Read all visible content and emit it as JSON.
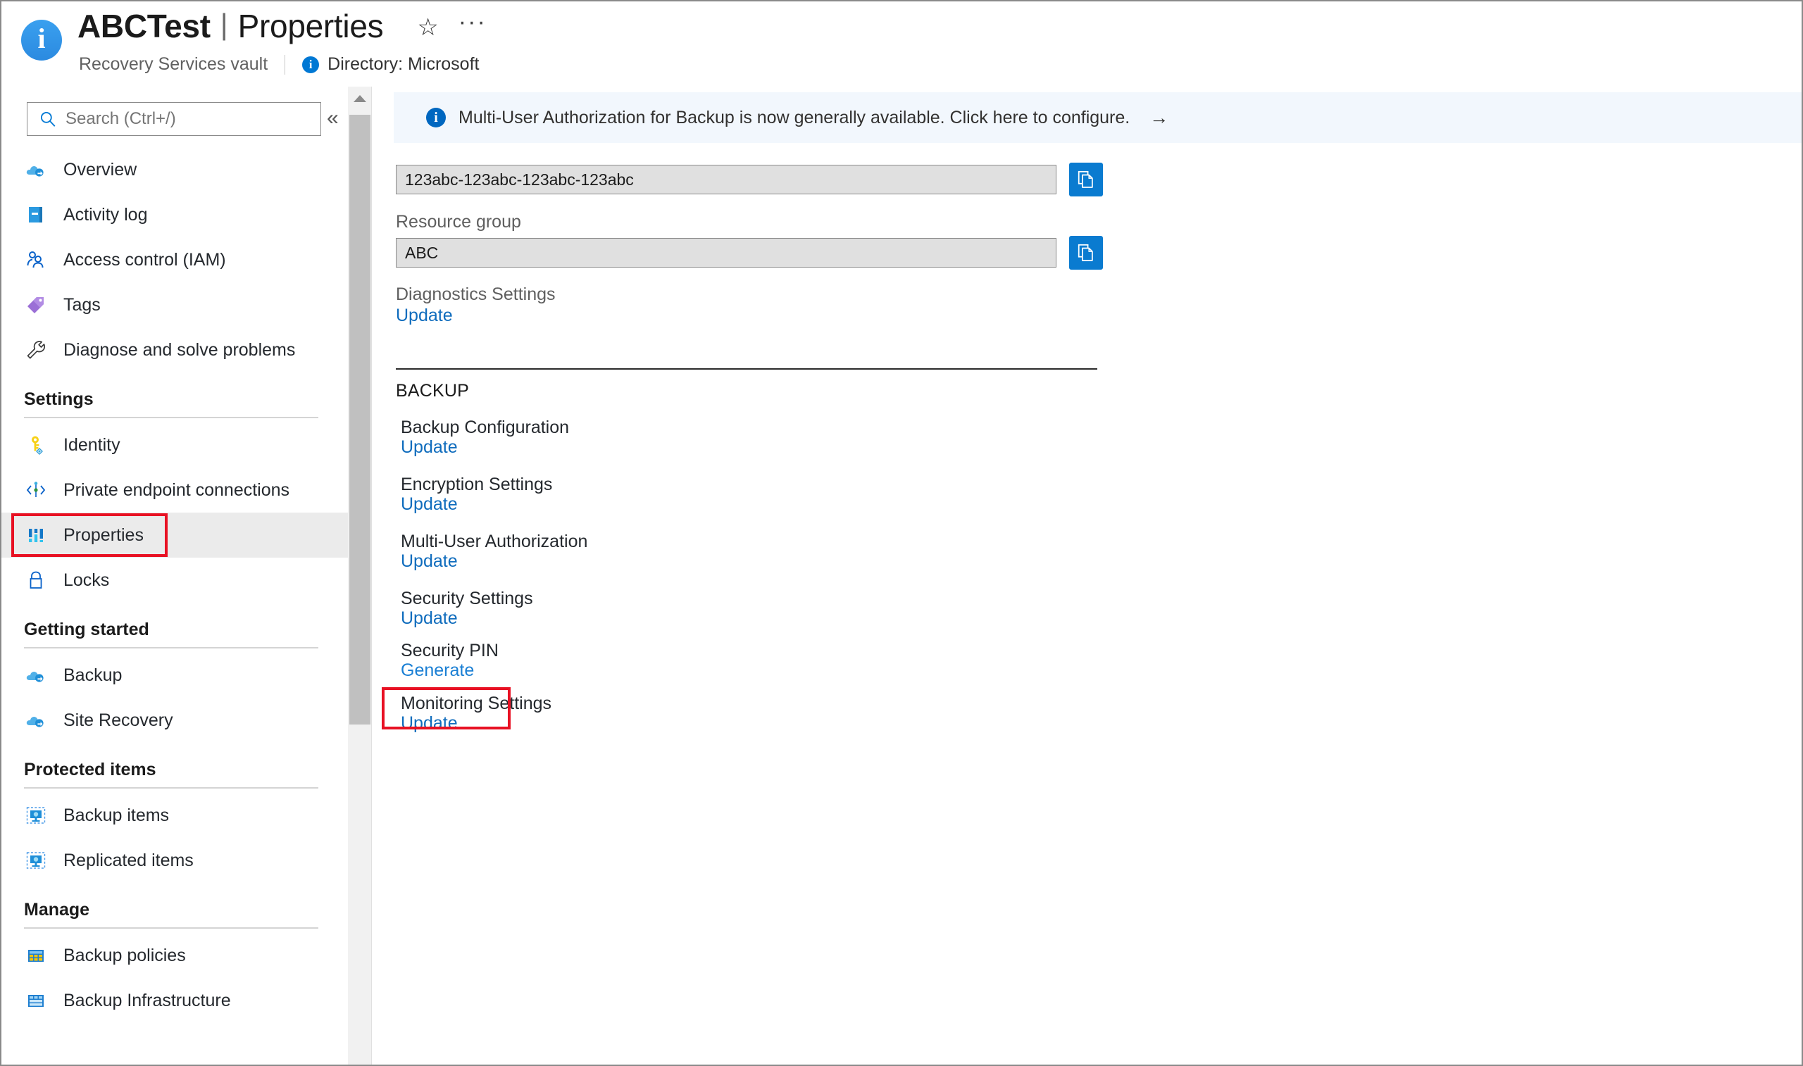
{
  "header": {
    "info_icon": "i",
    "resource_name": "ABCTest",
    "separator": "|",
    "page_name": "Properties",
    "favorite_icon": "☆",
    "more_icon": "···",
    "resource_type": "Recovery Services vault",
    "directory_icon": "i",
    "directory_label": "Directory: Microsoft"
  },
  "sidebar": {
    "search": {
      "placeholder": "Search (Ctrl+/)",
      "icon": "search-icon"
    },
    "collapse_icon": "«",
    "top_items": [
      {
        "label": "Overview",
        "icon": "cloud-icon"
      },
      {
        "label": "Activity log",
        "icon": "book-icon"
      },
      {
        "label": "Access control (IAM)",
        "icon": "people-icon"
      },
      {
        "label": "Tags",
        "icon": "tag-icon"
      },
      {
        "label": "Diagnose and solve problems",
        "icon": "wrench-icon"
      }
    ],
    "groups": [
      {
        "title": "Settings",
        "items": [
          {
            "label": "Identity",
            "icon": "key-icon",
            "selected": false
          },
          {
            "label": "Private endpoint connections",
            "icon": "endpoint-icon",
            "selected": false
          },
          {
            "label": "Properties",
            "icon": "properties-icon",
            "selected": true
          },
          {
            "label": "Locks",
            "icon": "lock-icon",
            "selected": false
          }
        ]
      },
      {
        "title": "Getting started",
        "items": [
          {
            "label": "Backup",
            "icon": "cloud-icon",
            "selected": false
          },
          {
            "label": "Site Recovery",
            "icon": "cloud-icon",
            "selected": false
          }
        ]
      },
      {
        "title": "Protected items",
        "items": [
          {
            "label": "Backup items",
            "icon": "vm-icon",
            "selected": false
          },
          {
            "label": "Replicated items",
            "icon": "vm-icon",
            "selected": false
          }
        ]
      },
      {
        "title": "Manage",
        "items": [
          {
            "label": "Backup policies",
            "icon": "grid-yellow-icon",
            "selected": false
          },
          {
            "label": "Backup Infrastructure",
            "icon": "grid-blue-icon",
            "selected": false
          }
        ]
      }
    ]
  },
  "main": {
    "banner": {
      "icon": "info-icon",
      "text": "Multi-User Authorization for Backup is now generally available. Click here to configure.",
      "arrow": "→"
    },
    "vault_id_value": "123abc-123abc-123abc-123abc",
    "vault_id_copy_icon": "copy-icon",
    "resource_group_label": "Resource group",
    "resource_group_value": "ABC",
    "resource_group_copy_icon": "copy-icon",
    "diagnostics": {
      "label": "Diagnostics Settings",
      "link": "Update"
    },
    "backup_section_title": "BACKUP",
    "backup_items": [
      {
        "title": "Backup Configuration",
        "link": "Update",
        "highlighted": false
      },
      {
        "title": "Encryption Settings",
        "link": "Update",
        "highlighted": false
      },
      {
        "title": "Multi-User Authorization",
        "link": "Update",
        "highlighted": false
      },
      {
        "title": "Security Settings",
        "link": "Update",
        "highlighted": false
      },
      {
        "title": "Security PIN",
        "link": "Generate",
        "highlighted": false
      },
      {
        "title": "Monitoring Settings",
        "link": "Update",
        "highlighted": true
      }
    ]
  },
  "colors": {
    "accent_blue": "#0078d4",
    "link_blue": "#0f6cbd",
    "highlight_red": "#e81123",
    "banner_bg": "#f2f7fd",
    "selected_bg": "#ebebeb",
    "field_bg": "#e0e0e0"
  }
}
